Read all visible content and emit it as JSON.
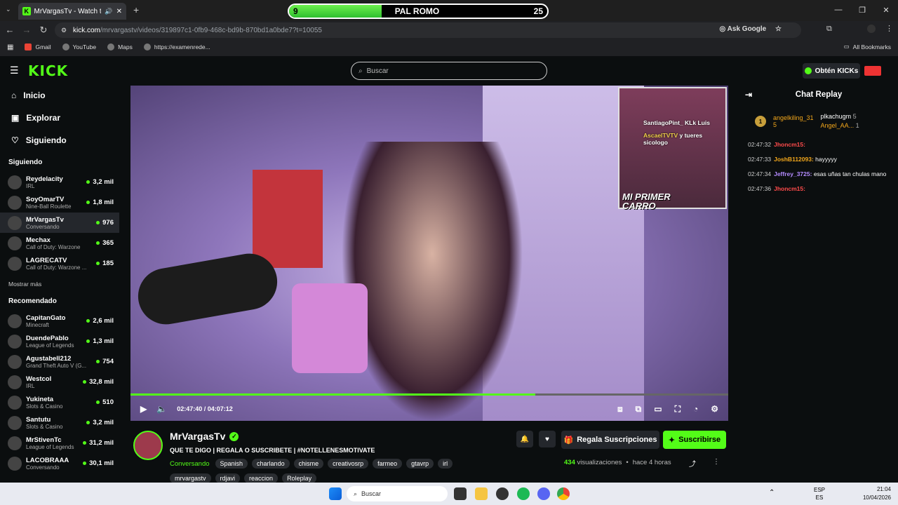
{
  "browser": {
    "tab_title": "MrVargasTv - Watch the VOD",
    "url_host": "kick.com",
    "url_path": "/mrvargastv/videos/319897c1-0fb9-468c-bd9b-870bd1a0bde7?t=10055",
    "ask_google": "Ask Google",
    "bookmarks": [
      "Gmail",
      "YouTube",
      "Maps",
      "https://examenrede..."
    ],
    "all_bookmarks": "All Bookmarks"
  },
  "score_overlay": {
    "left_score": "9",
    "name": "PAL ROMO",
    "right_score": "25"
  },
  "header": {
    "logo": "KICK",
    "search_placeholder": "Buscar",
    "kicks_button": "Obtén KICKs"
  },
  "sidebar": {
    "nav": [
      {
        "label": "Inicio",
        "icon": "home-icon"
      },
      {
        "label": "Explorar",
        "icon": "compass-icon"
      },
      {
        "label": "Siguiendo",
        "icon": "heart-icon"
      }
    ],
    "following_title": "Siguiendo",
    "following": [
      {
        "name": "Reydelacity",
        "category": "IRL",
        "viewers": "3,2 mil"
      },
      {
        "name": "SoyOmarTV",
        "category": "Nine-Ball Roulette",
        "viewers": "1,8 mil"
      },
      {
        "name": "MrVargasTv",
        "category": "Conversando",
        "viewers": "976"
      },
      {
        "name": "Mechax",
        "category": "Call of Duty: Warzone",
        "viewers": "365"
      },
      {
        "name": "LAGRECATV",
        "category": "Call of Duty: Warzone ...",
        "viewers": "185"
      }
    ],
    "show_more": "Mostrar más",
    "recommended_title": "Recomendado",
    "recommended": [
      {
        "name": "CapitanGato",
        "category": "Minecraft",
        "viewers": "2,6 mil"
      },
      {
        "name": "DuendePablo",
        "category": "League of Legends",
        "viewers": "1,3 mil"
      },
      {
        "name": "Agustabell212",
        "category": "Grand Theft Auto V (G...",
        "viewers": "754"
      },
      {
        "name": "Westcol",
        "category": "IRL",
        "viewers": "32,8 mil"
      },
      {
        "name": "Yukineta",
        "category": "Slots & Casino",
        "viewers": "510"
      },
      {
        "name": "Santutu",
        "category": "Slots & Casino",
        "viewers": "3,2 mil"
      },
      {
        "name": "MrStivenTc",
        "category": "League of Legends",
        "viewers": "31,2 mil"
      },
      {
        "name": "LACOBRAAA",
        "category": "Conversando",
        "viewers": "30,1 mil"
      }
    ]
  },
  "video": {
    "overlay_line1": "SantiagoPint_ KLk Luis",
    "overlay_user2": "AscaelTVTV",
    "overlay_line2": "y tueres sicologo",
    "cam_caption": "MI PRIMER CARRO",
    "current_time": "02:47:40",
    "duration": "04:07:12",
    "progress": 0.677
  },
  "stream_info": {
    "streamer": "MrVargasTv",
    "title": "QUE TE DIGO | REGALA O SUSCRIBETE | #NOTELLENESMOTIVATE",
    "category": "Conversando",
    "tags": [
      "Spanish",
      "charlando",
      "chisme",
      "creativosrp",
      "farmeo",
      "gtavrp",
      "irl",
      "mrvargastv",
      "rdjavi",
      "reaccion",
      "Roleplay"
    ],
    "gift_button": "Regala Suscripciones",
    "subscribe_button": "Suscribirse",
    "views_count": "434",
    "views_label": "visualizaciones",
    "time_ago": "hace 4 horas"
  },
  "chat": {
    "title": "Chat Replay",
    "top_gifter": {
      "rank": "1",
      "name": "angelkiling_31",
      "count": "5"
    },
    "gifter2": {
      "name": "plkachugm",
      "count": "5"
    },
    "gifter3": {
      "name": "Angel_AA...",
      "count": "1"
    },
    "messages": [
      {
        "time": "02:47:32",
        "user": "Jhoncm15:",
        "text": "",
        "color": "#ff4b4b"
      },
      {
        "time": "02:47:33",
        "user": "JoshB112093:",
        "text": "hayyyyy",
        "color": "#f3a71b"
      },
      {
        "time": "02:47:34",
        "user": "Jeffrey_3725:",
        "text": "esas uñas tan chulas mano",
        "color": "#b48bff"
      },
      {
        "time": "02:47:36",
        "user": "Jhoncm15:",
        "text": "",
        "color": "#ff4b4b"
      }
    ]
  },
  "taskbar": {
    "search": "Buscar",
    "lang_top": "ESP",
    "lang_bottom": "ES",
    "time": "21:04",
    "date": "10/04/2026"
  },
  "colors": {
    "accent": "#53fc18",
    "background": "#0b0e0f"
  }
}
